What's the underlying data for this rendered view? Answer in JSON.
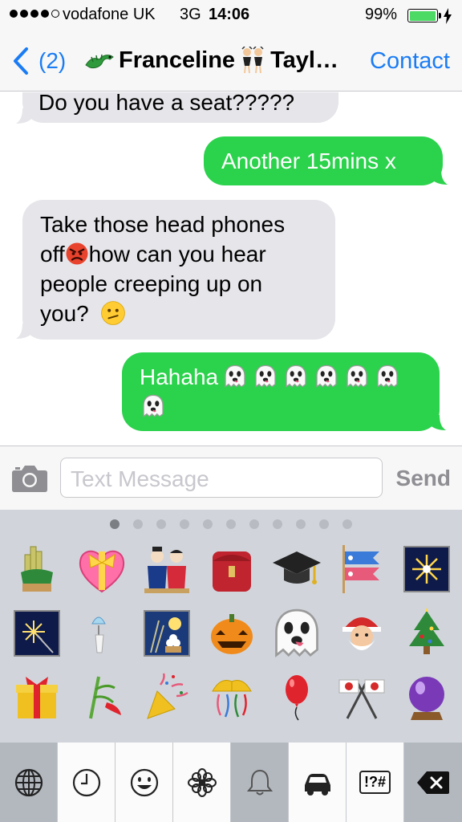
{
  "status_bar": {
    "carrier": "vodafone UK",
    "network": "3G",
    "time": "14:06",
    "battery_percent": "99%",
    "battery_level": 0.99,
    "signal_bars": 4,
    "signal_max": 5
  },
  "nav": {
    "back_count": "(2)",
    "title": "Franceline",
    "title_suffix": "Tayl…",
    "contact_label": "Contact"
  },
  "messages": [
    {
      "direction": "in",
      "text": "Do you have a seat?????"
    },
    {
      "direction": "out",
      "text": "Another 15mins x"
    },
    {
      "direction": "in",
      "line1": "Take those head phones",
      "line2a": "off",
      "line2b": "how can you hear",
      "line3": "people creeping up on",
      "line4": "you?"
    },
    {
      "direction": "out",
      "text": "Hahaha"
    }
  ],
  "input_bar": {
    "placeholder": "Text Message",
    "send_label": "Send"
  },
  "keyboard": {
    "page_count": 11,
    "active_page": 0,
    "emojis": [
      "kadomatsu",
      "heart-with-ribbon",
      "japanese-dolls",
      "school-satchel",
      "graduation-cap",
      "carp-streamer",
      "fireworks",
      "sparkler",
      "wind-chime",
      "moon-viewing-ceremony",
      "jack-o-lantern",
      "ghost",
      "santa-claus",
      "christmas-tree",
      "wrapped-present",
      "tanabata-tree",
      "party-popper",
      "confetti-ball",
      "balloon",
      "crossed-flags",
      "crystal-ball"
    ],
    "categories": [
      "globe-icon",
      "recent-clock-icon",
      "smiley-icon",
      "flower-icon",
      "bell-icon",
      "car-icon",
      "symbols-icon",
      "delete-icon"
    ],
    "symbols_label": "!?#",
    "active_category": "bell-icon"
  },
  "colors": {
    "accent": "#1a7cf4",
    "outgoing_bubble": "#2bd24c",
    "incoming_bubble": "#e5e5ea",
    "keyboard_bg": "#d1d5db"
  }
}
